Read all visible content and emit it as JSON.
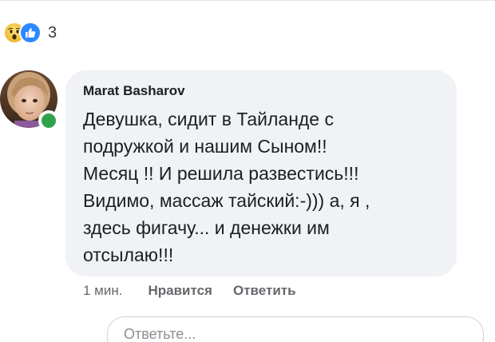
{
  "reactions": {
    "icons": [
      "wow-icon",
      "like-icon"
    ],
    "count": "3"
  },
  "comment": {
    "author": "Marat Basharov",
    "author_online": true,
    "text_lines": [
      "Девушка, сидит в Тайланде с",
      "подружкой и нашим Сыном!!",
      "Месяц !! И решила развестись!!!",
      "Видимо, массаж тайский:-))) а, я ,",
      "здесь фигачу... и денежки им",
      "отсылаю!!!"
    ],
    "time": "1 мин.",
    "like_label": "Нравится",
    "reply_label": "Ответить"
  },
  "reply_box": {
    "placeholder": "Ответьте..."
  },
  "colors": {
    "bubble": "#f0f2f5",
    "like_blue": "#2d88ff",
    "wow_yellow": "#f7c94b",
    "online_green": "#31a24c",
    "meta_gray": "#65676b"
  }
}
